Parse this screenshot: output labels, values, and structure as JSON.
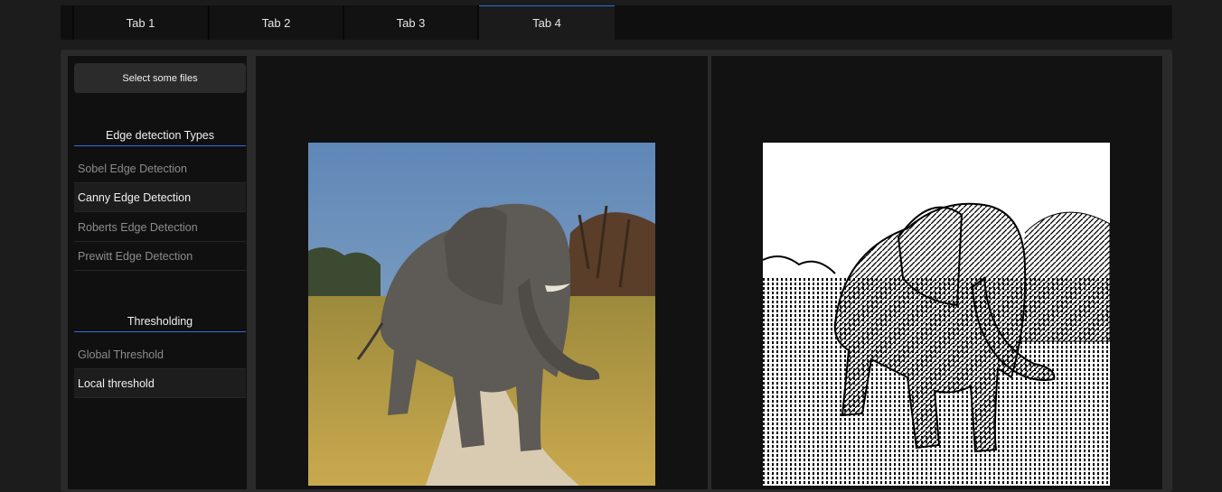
{
  "tabs": [
    {
      "label": "Tab 1",
      "active": false
    },
    {
      "label": "Tab 2",
      "active": false
    },
    {
      "label": "Tab 3",
      "active": false
    },
    {
      "label": "Tab 4",
      "active": true
    }
  ],
  "sidebar": {
    "select_files_label": "Select some files",
    "edge_section": {
      "title": "Edge detection Types",
      "items": [
        {
          "label": "Sobel Edge Detection",
          "active": false
        },
        {
          "label": "Canny Edge Detection",
          "active": true
        },
        {
          "label": "Roberts Edge Detection",
          "active": false
        },
        {
          "label": "Prewitt Edge Detection",
          "active": false
        }
      ]
    },
    "threshold_section": {
      "title": "Thresholding",
      "items": [
        {
          "label": "Global Threshold",
          "active": false
        },
        {
          "label": "Local threshold",
          "active": true
        }
      ]
    }
  },
  "viewers": {
    "input_image": "elephant-photo",
    "output_image": "elephant-edge-map"
  },
  "colors": {
    "accent": "#2f6fe0",
    "background": "#1c1c1c",
    "panel": "#101010"
  }
}
